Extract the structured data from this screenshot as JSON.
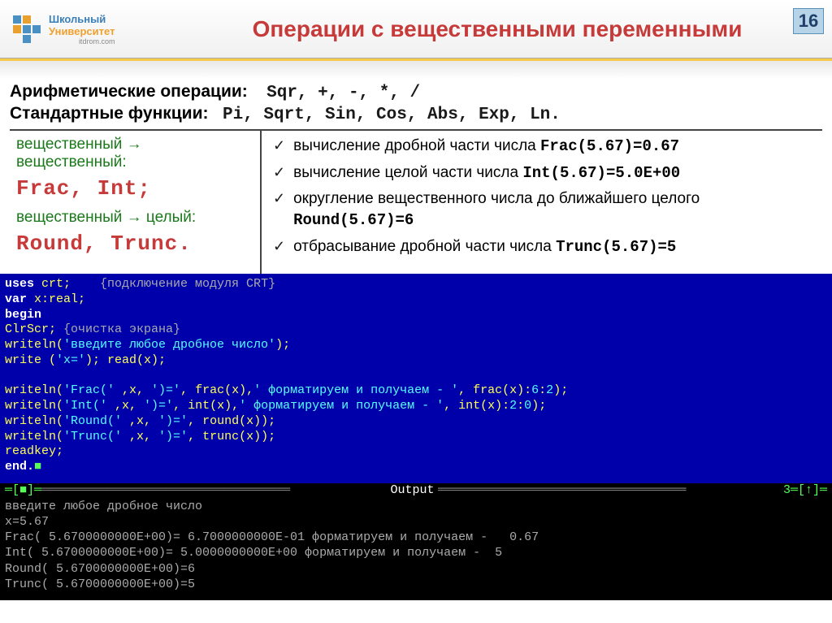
{
  "header": {
    "logo": {
      "line1": "Школьный",
      "line2": "Университет",
      "line3": "itdrom.com"
    },
    "title": "Операции с вещественными переменными",
    "slide_number": "16"
  },
  "content": {
    "arith_label": "Арифметические операции:",
    "arith_ops": "Sqr, +, -, *, /",
    "std_label": "Стандартные функции:",
    "std_funcs": "Pi, Sqrt, Sin, Cos, Abs, Exp, Ln."
  },
  "left": {
    "grn1": "вещественный → вещественный:",
    "red1": "Frac, Int;",
    "grn2": "вещественный → целый:",
    "red2": "Round, Trunc."
  },
  "right": {
    "i1_text": "вычисление дробной части числа ",
    "i1_code": "Frac(5.67)=0.67",
    "i2_text": "вычисление целой части числа ",
    "i2_code": "Int(5.67)=5.0E+00",
    "i3_text": "округление вещественного числа до ближайшего целого ",
    "i3_code": "Round(5.67)=6",
    "i4_text": "отбрасывание дробной части числа ",
    "i4_code": "Trunc(5.67)=5"
  },
  "code": {
    "l1a": "uses",
    "l1b": " crt;    ",
    "l1c": "{подключение модуля CRT}",
    "l2a": "var",
    "l2b": " x:real;",
    "l3": "begin",
    "l4a": "ClrScr; ",
    "l4b": "{очистка экрана}",
    "l5a": "writeln(",
    "l5b": "'введите любое дробное число'",
    "l5c": ");",
    "l6a": "write (",
    "l6b": "'x='",
    "l6c": "); read(x);",
    "l7a": "writeln(",
    "l7b": "'Frac('",
    "l7c": " ,x, ",
    "l7d": "')='",
    "l7e": ", frac(x),",
    "l7f": "' форматируем и получаем - '",
    "l7g": ", frac(x):",
    "l7h": "6",
    "l7i": ":",
    "l7j": "2",
    "l7k": ");",
    "l8a": "writeln(",
    "l8b": "'Int('",
    "l8c": " ,x, ",
    "l8d": "')='",
    "l8e": ", int(x),",
    "l8f": "' форматируем и получаем - '",
    "l8g": ", int(x):",
    "l8h": "2",
    "l8i": ":",
    "l8j": "0",
    "l8k": ");",
    "l9a": "writeln(",
    "l9b": "'Round('",
    "l9c": " ,x, ",
    "l9d": "')='",
    "l9e": ", round(x));",
    "l10a": "writeln(",
    "l10b": "'Trunc('",
    "l10c": " ,x, ",
    "l10d": "')='",
    "l10e": ", trunc(x));",
    "l11": "readkey;",
    "l12": "end.",
    "out_label": "Output",
    "out_num": "3",
    "o1": "введите любое дробное число",
    "o2": "x=5.67",
    "o3": "Frac( 5.6700000000E+00)= 6.7000000000E-01 форматируем и получаем -   0.67",
    "o4": "Int( 5.6700000000E+00)= 5.0000000000E+00 форматируем и получаем -  5",
    "o5": "Round( 5.6700000000E+00)=6",
    "o6": "Trunc( 5.6700000000E+00)=5"
  }
}
